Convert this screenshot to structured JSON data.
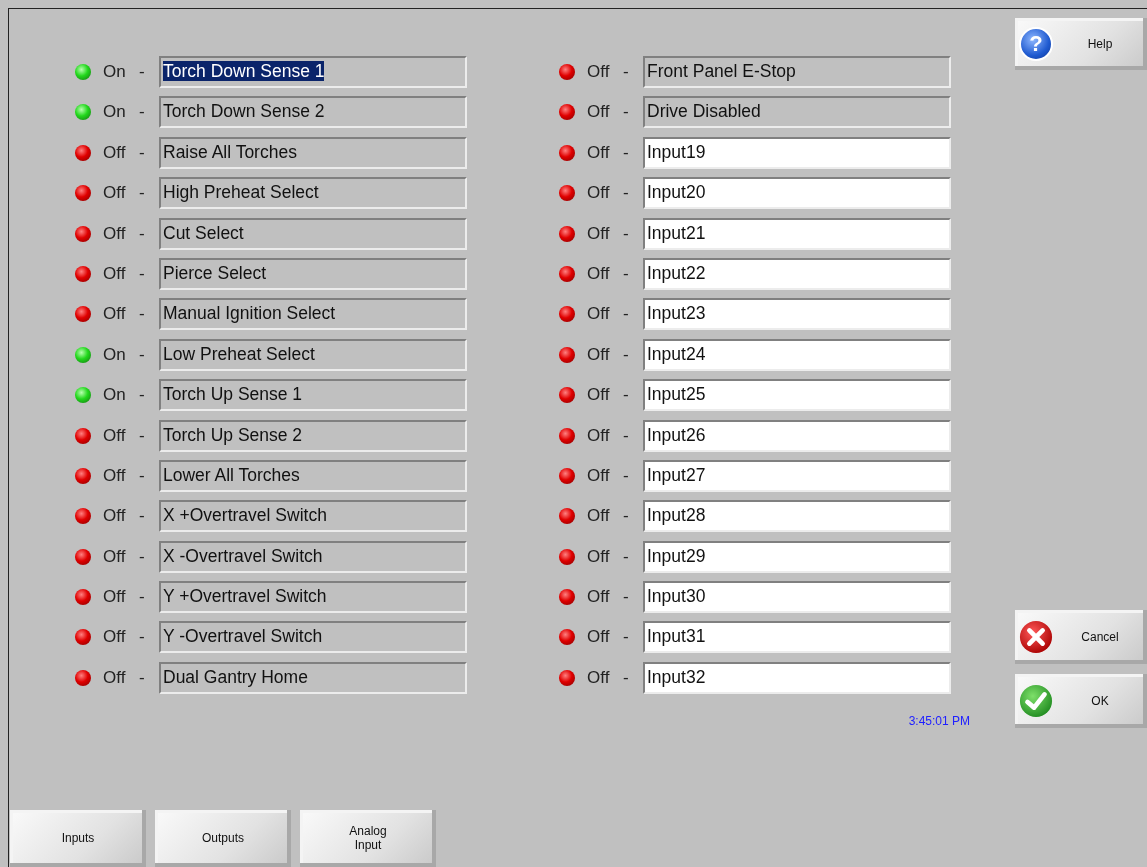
{
  "left_inputs": [
    {
      "on": true,
      "status": "On",
      "separator": "-",
      "name": "Torch Down Sense 1",
      "editable": false,
      "selected": true
    },
    {
      "on": true,
      "status": "On",
      "separator": "-",
      "name": "Torch Down Sense 2",
      "editable": false,
      "selected": false
    },
    {
      "on": false,
      "status": "Off",
      "separator": "-",
      "name": "Raise All Torches",
      "editable": false,
      "selected": false
    },
    {
      "on": false,
      "status": "Off",
      "separator": "-",
      "name": "High Preheat Select",
      "editable": false,
      "selected": false
    },
    {
      "on": false,
      "status": "Off",
      "separator": "-",
      "name": "Cut Select",
      "editable": false,
      "selected": false
    },
    {
      "on": false,
      "status": "Off",
      "separator": "-",
      "name": "Pierce Select",
      "editable": false,
      "selected": false
    },
    {
      "on": false,
      "status": "Off",
      "separator": "-",
      "name": "Manual Ignition Select",
      "editable": false,
      "selected": false
    },
    {
      "on": true,
      "status": "On",
      "separator": "-",
      "name": "Low Preheat Select",
      "editable": false,
      "selected": false
    },
    {
      "on": true,
      "status": "On",
      "separator": "-",
      "name": "Torch Up Sense 1",
      "editable": false,
      "selected": false
    },
    {
      "on": false,
      "status": "Off",
      "separator": "-",
      "name": "Torch Up Sense 2",
      "editable": false,
      "selected": false
    },
    {
      "on": false,
      "status": "Off",
      "separator": "-",
      "name": "Lower All Torches",
      "editable": false,
      "selected": false
    },
    {
      "on": false,
      "status": "Off",
      "separator": "-",
      "name": "X +Overtravel Switch",
      "editable": false,
      "selected": false
    },
    {
      "on": false,
      "status": "Off",
      "separator": "-",
      "name": "X -Overtravel Switch",
      "editable": false,
      "selected": false
    },
    {
      "on": false,
      "status": "Off",
      "separator": "-",
      "name": "Y +Overtravel Switch",
      "editable": false,
      "selected": false
    },
    {
      "on": false,
      "status": "Off",
      "separator": "-",
      "name": "Y -Overtravel Switch",
      "editable": false,
      "selected": false
    },
    {
      "on": false,
      "status": "Off",
      "separator": "-",
      "name": "Dual Gantry Home",
      "editable": false,
      "selected": false
    }
  ],
  "right_inputs": [
    {
      "on": false,
      "status": "Off",
      "separator": "-",
      "name": "Front Panel E-Stop",
      "editable": false,
      "selected": false
    },
    {
      "on": false,
      "status": "Off",
      "separator": "-",
      "name": "Drive Disabled",
      "editable": false,
      "selected": false
    },
    {
      "on": false,
      "status": "Off",
      "separator": "-",
      "name": "Input19",
      "editable": true,
      "selected": false
    },
    {
      "on": false,
      "status": "Off",
      "separator": "-",
      "name": "Input20",
      "editable": true,
      "selected": false
    },
    {
      "on": false,
      "status": "Off",
      "separator": "-",
      "name": "Input21",
      "editable": true,
      "selected": false
    },
    {
      "on": false,
      "status": "Off",
      "separator": "-",
      "name": "Input22",
      "editable": true,
      "selected": false
    },
    {
      "on": false,
      "status": "Off",
      "separator": "-",
      "name": "Input23",
      "editable": true,
      "selected": false
    },
    {
      "on": false,
      "status": "Off",
      "separator": "-",
      "name": "Input24",
      "editable": true,
      "selected": false
    },
    {
      "on": false,
      "status": "Off",
      "separator": "-",
      "name": "Input25",
      "editable": true,
      "selected": false
    },
    {
      "on": false,
      "status": "Off",
      "separator": "-",
      "name": "Input26",
      "editable": true,
      "selected": false
    },
    {
      "on": false,
      "status": "Off",
      "separator": "-",
      "name": "Input27",
      "editable": true,
      "selected": false
    },
    {
      "on": false,
      "status": "Off",
      "separator": "-",
      "name": "Input28",
      "editable": true,
      "selected": false
    },
    {
      "on": false,
      "status": "Off",
      "separator": "-",
      "name": "Input29",
      "editable": true,
      "selected": false
    },
    {
      "on": false,
      "status": "Off",
      "separator": "-",
      "name": "Input30",
      "editable": true,
      "selected": false
    },
    {
      "on": false,
      "status": "Off",
      "separator": "-",
      "name": "Input31",
      "editable": true,
      "selected": false
    },
    {
      "on": false,
      "status": "Off",
      "separator": "-",
      "name": "Input32",
      "editable": true,
      "selected": false
    }
  ],
  "time": "3:45:01 PM",
  "help_button": {
    "icon": "?",
    "label": "Help"
  },
  "cancel_button": {
    "label": "Cancel"
  },
  "ok_button": {
    "label": "OK"
  },
  "tabs": [
    {
      "label": "Inputs"
    },
    {
      "label": "Outputs"
    },
    {
      "label": "Analog Input"
    }
  ]
}
